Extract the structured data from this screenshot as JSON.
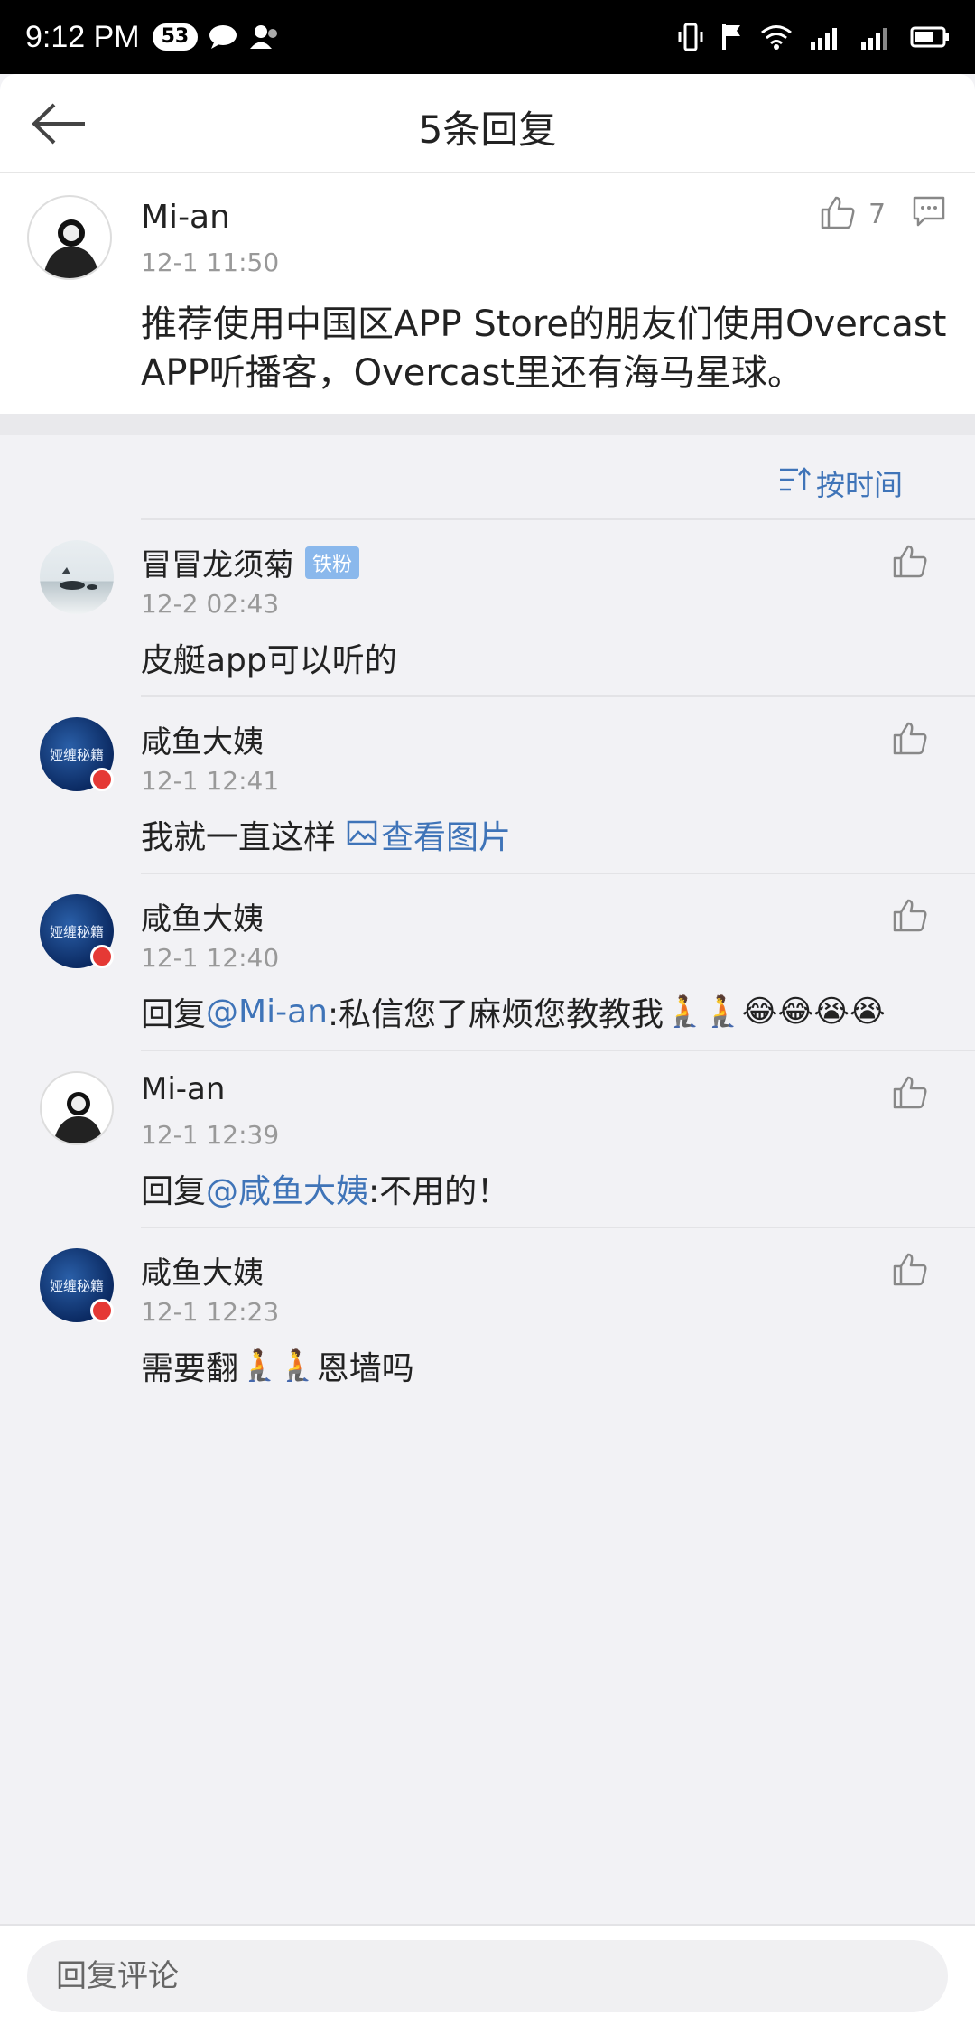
{
  "status_bar": {
    "time": "9:12 PM",
    "notification_count": "53"
  },
  "header": {
    "title": "5条回复",
    "back_icon": "arrow-left-icon"
  },
  "root_comment": {
    "user": "Mi-an",
    "time": "12-1 11:50",
    "text": "推荐使用中国区APP Store的朋友们使用Overcast APP听播客，Overcast里还有海马星球。",
    "likes": "7"
  },
  "sort": {
    "label": "按时间"
  },
  "replies": [
    {
      "user": "冒冒龙须菊",
      "badge": "铁粉",
      "time": "12-2 02:43",
      "text": "皮艇app可以听的",
      "avatar": "landscape"
    },
    {
      "user": "咸鱼大姨",
      "time": "12-1 12:41",
      "text": "我就一直这样",
      "link": "查看图片",
      "avatar": "sea"
    },
    {
      "user": "咸鱼大姨",
      "time": "12-1 12:40",
      "prefix": "回复",
      "mention": "@Mi-an",
      "text": ":私信您了麻烦您教教我",
      "emojis": "🧎🧎😂😂😭😭",
      "avatar": "sea"
    },
    {
      "user": "Mi-an",
      "time": "12-1 12:39",
      "prefix": "回复",
      "mention": "@咸鱼大姨",
      "text": ":不用的！",
      "avatar": "person"
    },
    {
      "user": "咸鱼大姨",
      "time": "12-1 12:23",
      "text_a": "需要翻",
      "emojis": "🧎🧎",
      "text_b": "恩墙吗",
      "avatar": "sea"
    }
  ],
  "avatar_sea_label": "娅缠秘籍",
  "bottom": {
    "placeholder": "回复评论"
  }
}
